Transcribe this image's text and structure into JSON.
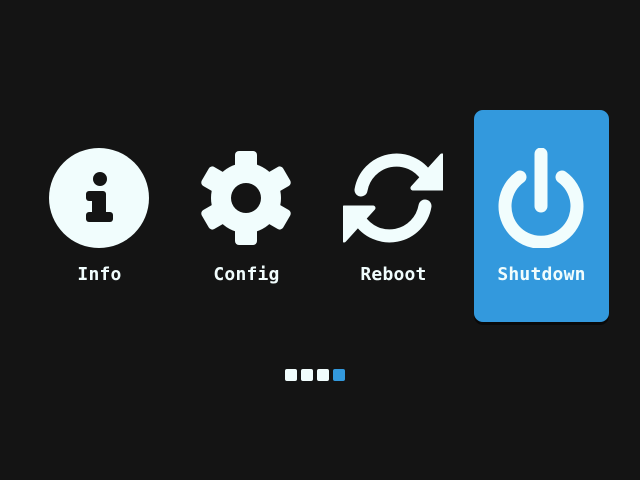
{
  "colors": {
    "background": "#141414",
    "foreground": "#f1fdfd",
    "accent": "#3399dd",
    "glyph_on_light": "#141414"
  },
  "menu": {
    "selected_index": 3,
    "items": [
      {
        "label": "Info",
        "icon": "info-icon"
      },
      {
        "label": "Config",
        "icon": "gear-icon"
      },
      {
        "label": "Reboot",
        "icon": "refresh-icon"
      },
      {
        "label": "Shutdown",
        "icon": "power-icon"
      }
    ]
  },
  "pager": {
    "page_count": 4,
    "current_page": 4
  }
}
